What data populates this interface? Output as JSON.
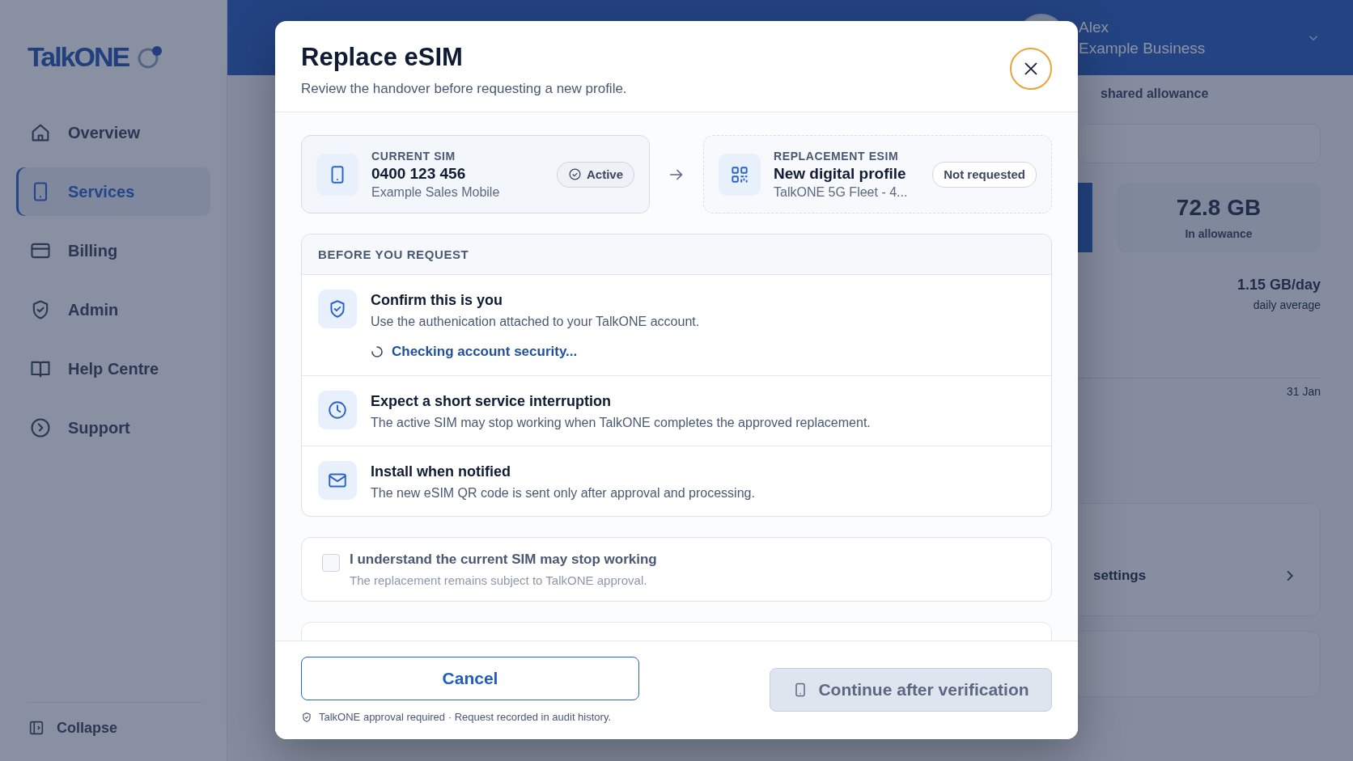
{
  "sidebar": {
    "logo": "TalkONE",
    "nav": [
      {
        "label": "Overview",
        "kind": "home",
        "selected": false
      },
      {
        "label": "Services",
        "kind": "phone",
        "selected": true
      },
      {
        "label": "Billing",
        "kind": "card",
        "selected": false
      },
      {
        "label": "Admin",
        "kind": "shield",
        "selected": false
      },
      {
        "label": "Help Centre",
        "kind": "book",
        "selected": false
      },
      {
        "label": "Support",
        "kind": "support",
        "selected": false
      }
    ],
    "collapse": "Collapse"
  },
  "header": {
    "user_name": "Alex",
    "business": "Example Business"
  },
  "dashboard": {
    "allowance_caption": "shared allowance",
    "stat_value": "72.8 GB",
    "stat_caption": "In allowance",
    "average_value": "1.15 GB/day",
    "average_caption": "daily average",
    "chart_date": "31 Jan",
    "settings_link": "settings"
  },
  "dialog": {
    "title": "Replace eSIM",
    "subtitle": "Review the handover before requesting a new profile.",
    "current": {
      "label": "CURRENT SIM",
      "number": "0400 123 456",
      "name": "Example Sales Mobile",
      "status": "Active"
    },
    "replacement": {
      "label": "REPLACEMENT ESIM",
      "title": "New digital profile",
      "plan": "TalkONE 5G Fleet - 4...",
      "status": "Not requested"
    },
    "checklist": {
      "heading": "BEFORE YOU REQUEST",
      "items": [
        {
          "kind": "shield",
          "title": "Confirm this is you",
          "text": "Use the authenication attached to your TalkONE account.",
          "status": "Checking account security..."
        },
        {
          "kind": "clock",
          "title": "Expect a short service interruption",
          "text": "The active SIM may stop working when TalkONE completes the approved replacement."
        },
        {
          "kind": "mail",
          "title": "Install when notified",
          "text": "The new eSIM QR code is sent only after approval and processing."
        }
      ]
    },
    "acknowledge": {
      "checked": false,
      "title": "I understand the current SIM may stop working",
      "text": "The replacement remains subject to TalkONE approval."
    },
    "footer": {
      "cancel": "Cancel",
      "note": "TalkONE approval required · Request recorded in audit history.",
      "continue": {
        "label": "Continue after verification",
        "disabled": true
      }
    }
  }
}
